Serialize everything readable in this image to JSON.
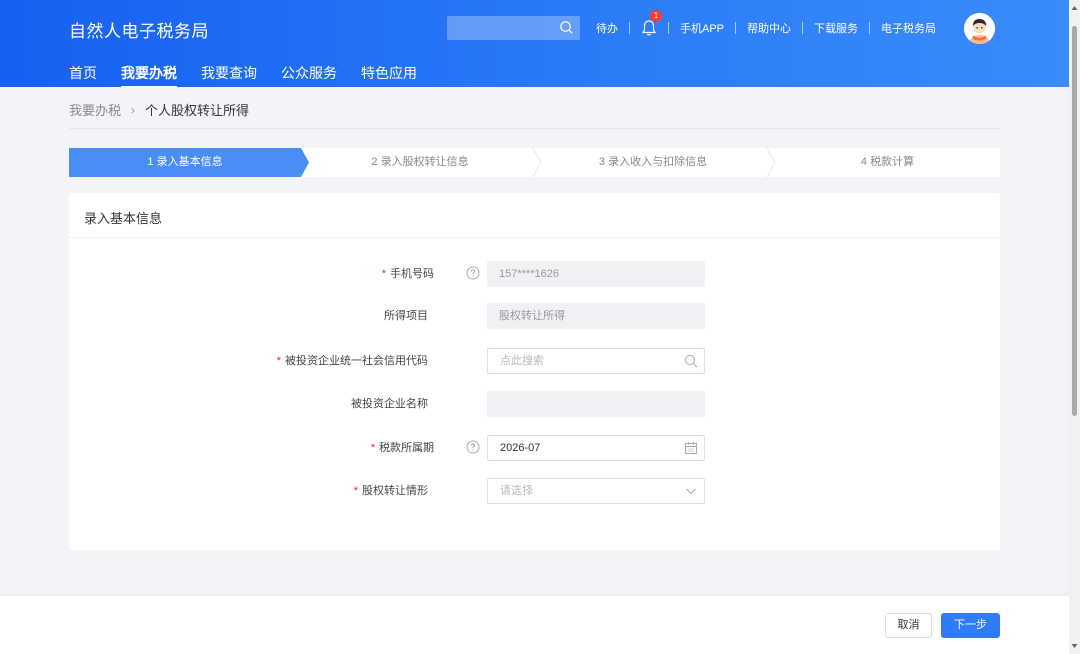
{
  "header": {
    "logo": "自然人电子税务局",
    "search_placeholder": "",
    "links": {
      "todo": "待办",
      "badge": "1",
      "app": "手机APP",
      "help": "帮助中心",
      "download": "下载服务",
      "bureau": "电子税务局"
    },
    "nav": [
      "首页",
      "我要办税",
      "我要查询",
      "公众服务",
      "特色应用"
    ],
    "nav_active": "我要办税"
  },
  "breadcrumb": {
    "parent": "我要办税",
    "separator": "›",
    "current": "个人股权转让所得"
  },
  "steps": [
    "1  录入基本信息",
    "2  录入股权转让信息",
    "3  录入收入与扣除信息",
    "4  税款计算"
  ],
  "active_step": 1,
  "form": {
    "title": "录入基本信息",
    "required_mark": "*",
    "rows": [
      {
        "label": "手机号码",
        "required": true,
        "help": true,
        "value": "157****1626",
        "placeholder": "",
        "state": "disabled",
        "icon": ""
      },
      {
        "label": "所得项目",
        "required": false,
        "help": false,
        "value": "股权转让所得",
        "placeholder": "",
        "state": "disabled",
        "icon": ""
      },
      {
        "label": "被投资企业统一社会信用代码",
        "required": true,
        "help": false,
        "value": "",
        "placeholder": "点此搜索",
        "state": "enabled",
        "icon": "search-icon"
      },
      {
        "label": "被投资企业名称",
        "required": false,
        "help": false,
        "value": "",
        "placeholder": "",
        "state": "disabled",
        "icon": ""
      },
      {
        "label": "税款所属期",
        "required": true,
        "help": true,
        "value": "2026-07",
        "placeholder": "",
        "state": "enabled",
        "icon": "calendar-icon"
      },
      {
        "label": "股权转让情形",
        "required": true,
        "help": false,
        "value": "",
        "placeholder": "请选择",
        "state": "enabled",
        "icon": "chevron-down-icon"
      }
    ]
  },
  "footer": {
    "cancel": "取消",
    "next": "下一步"
  },
  "colors": {
    "primary": "#2f7cf6",
    "header_start": "#1660f0",
    "header_end": "#3a8cfb",
    "required": "#f5222d"
  }
}
